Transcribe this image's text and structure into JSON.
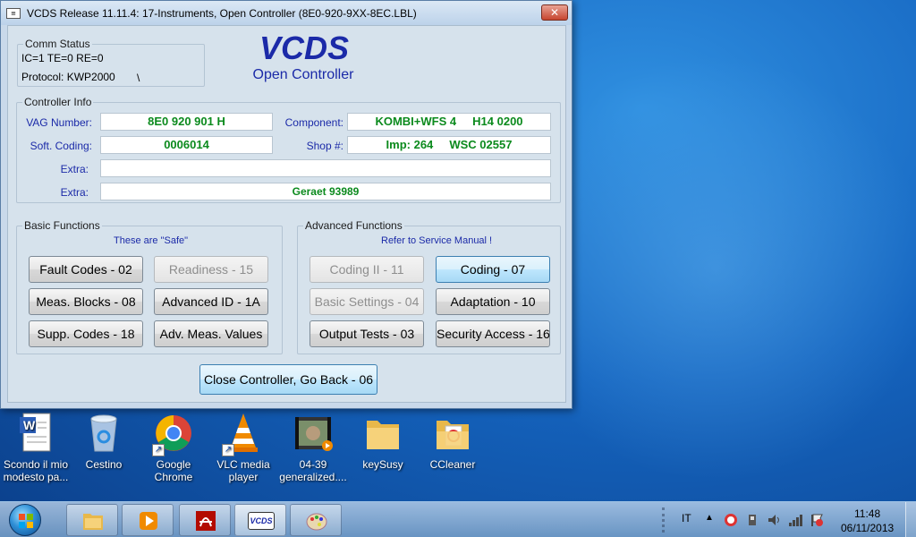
{
  "window": {
    "title": "VCDS Release 11.11.4: 17-Instruments,  Open Controller (8E0-920-9XX-8EC.LBL)",
    "icon_text": "≡",
    "close_label": "✕"
  },
  "comm_status": {
    "label": "Comm Status",
    "line1": "IC=1  TE=0  RE=0",
    "protocol": "Protocol: KWP2000",
    "activity": "\\"
  },
  "brand": {
    "title": "VCDS",
    "subtitle": "Open Controller"
  },
  "controller_info": {
    "label": "Controller Info",
    "vag_number_label": "VAG Number:",
    "vag_number": "8E0 920 901 H",
    "component_label": "Component:",
    "component": "KOMBI+WFS 4     H14 0200",
    "soft_coding_label": "Soft. Coding:",
    "soft_coding": "0006014",
    "shop_label": "Shop #:",
    "shop": "Imp: 264     WSC 02557",
    "extra1_label": "Extra:",
    "extra1": "",
    "extra2_label": "Extra:",
    "extra2": "Geraet 93989"
  },
  "basic_functions": {
    "label": "Basic Functions",
    "hint": "These are \"Safe\"",
    "buttons": [
      "Fault Codes - 02",
      "Readiness - 15",
      "Meas. Blocks - 08",
      "Advanced ID - 1A",
      "Supp. Codes - 18",
      "Adv. Meas. Values"
    ]
  },
  "advanced_functions": {
    "label": "Advanced Functions",
    "hint": "Refer to Service Manual !",
    "buttons": [
      "Coding II - 11",
      "Coding - 07",
      "Basic Settings - 04",
      "Adaptation - 10",
      "Output Tests - 03",
      "Security Access - 16"
    ]
  },
  "close_button": "Close Controller, Go Back - 06",
  "desktop_icons": [
    {
      "line1": "Scondo il mio",
      "line2": "modesto pa...",
      "icon": "word-document-icon"
    },
    {
      "line1": "Cestino",
      "line2": "",
      "icon": "recycle-bin-icon"
    },
    {
      "line1": "Google",
      "line2": "Chrome",
      "icon": "chrome-icon"
    },
    {
      "line1": "VLC media",
      "line2": "player",
      "icon": "vlc-icon"
    },
    {
      "line1": "04-39",
      "line2": "generalized....",
      "icon": "video-file-icon"
    },
    {
      "line1": "keySusy",
      "line2": "",
      "icon": "folder-icon"
    },
    {
      "line1": "CCleaner",
      "line2": "",
      "icon": "folder-icon"
    }
  ],
  "taskbar": {
    "apps": [
      "explorer-icon",
      "media-player-icon",
      "acrobat-icon",
      "vcds-icon",
      "paint-icon"
    ],
    "vcds_text": "VCDS",
    "language": "IT",
    "time": "11:48",
    "date": "06/11/2013"
  },
  "colors": {
    "accent_blue": "#1b2aa8",
    "value_green": "#0b8a1d",
    "desktop": "#1565c0"
  }
}
